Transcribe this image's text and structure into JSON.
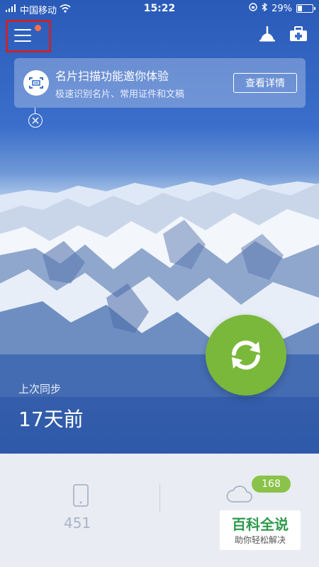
{
  "status_bar": {
    "carrier": "中国移动",
    "time": "15:22",
    "battery": "29%",
    "battery_level": 0.29
  },
  "promo": {
    "title": "名片扫描功能邀你体验",
    "subtitle": "极速识别名片、常用证件和文稿",
    "button": "查看详情"
  },
  "sync": {
    "label": "上次同步",
    "time": "17天前"
  },
  "stats": {
    "phone_count": "451",
    "cloud_count": "168"
  },
  "watermark": {
    "title": "百科全说",
    "subtitle": "助你轻松解决"
  },
  "colors": {
    "accent_green": "#7ab83b",
    "badge_green": "#8bc34a",
    "menu_dot": "#ff6d4a",
    "highlight_box": "#c4252e"
  },
  "icons": {
    "menu": "hamburger-icon",
    "clean": "broom-icon",
    "toolbox": "toolbox-icon",
    "scan": "card-scan-icon",
    "close": "close-icon",
    "sync": "refresh-icon",
    "phone": "phone-icon",
    "cloud": "cloud-icon"
  }
}
